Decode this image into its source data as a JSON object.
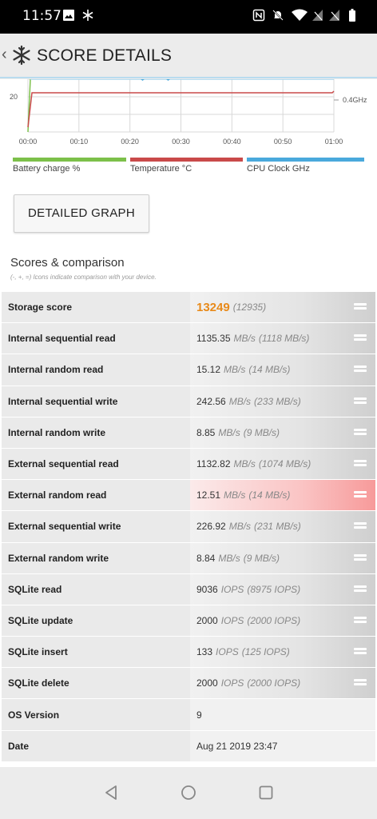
{
  "status": {
    "time": "11:57"
  },
  "app": {
    "title": "SCORE DETAILS"
  },
  "chart_data": {
    "type": "line",
    "x_ticks": [
      "00:00",
      "00:10",
      "00:20",
      "00:30",
      "00:40",
      "00:50",
      "01:00"
    ],
    "left_ticks": [
      "20"
    ],
    "right_ticks": [
      "0.4GHz"
    ],
    "series": [
      {
        "name": "Battery charge %",
        "color": "#7cc04a"
      },
      {
        "name": "Temperature °C",
        "color": "#c94a4a"
      },
      {
        "name": "CPU Clock GHz",
        "color": "#4aa9dc"
      }
    ]
  },
  "detailed_graph_label": "DETAILED GRAPH",
  "scores": {
    "title": "Scores & comparison",
    "subtitle": "(-, +, =) Icons indicate comparison with your device.",
    "rows": [
      {
        "label": "Storage score",
        "value": "13249",
        "unit": "",
        "compare": "(12935)"
      },
      {
        "label": "Internal sequential read",
        "value": "1135.35",
        "unit": "MB/s",
        "compare": "(1118 MB/s)"
      },
      {
        "label": "Internal random read",
        "value": "15.12",
        "unit": "MB/s",
        "compare": "(14 MB/s)"
      },
      {
        "label": "Internal sequential write",
        "value": "242.56",
        "unit": "MB/s",
        "compare": "(233 MB/s)"
      },
      {
        "label": "Internal random write",
        "value": "8.85",
        "unit": "MB/s",
        "compare": "(9 MB/s)"
      },
      {
        "label": "External sequential read",
        "value": "1132.82",
        "unit": "MB/s",
        "compare": "(1074 MB/s)"
      },
      {
        "label": "External random read",
        "value": "12.51",
        "unit": "MB/s",
        "compare": "(14 MB/s)"
      },
      {
        "label": "External sequential write",
        "value": "226.92",
        "unit": "MB/s",
        "compare": "(231 MB/s)"
      },
      {
        "label": "External random write",
        "value": "8.84",
        "unit": "MB/s",
        "compare": "(9 MB/s)"
      },
      {
        "label": "SQLite read",
        "value": "9036",
        "unit": "IOPS",
        "compare": "(8975 IOPS)"
      },
      {
        "label": "SQLite update",
        "value": "2000",
        "unit": "IOPS",
        "compare": "(2000 IOPS)"
      },
      {
        "label": "SQLite insert",
        "value": "133",
        "unit": "IOPS",
        "compare": "(125 IOPS)"
      },
      {
        "label": "SQLite delete",
        "value": "2000",
        "unit": "IOPS",
        "compare": "(2000 IOPS)"
      },
      {
        "label": "OS Version",
        "value": "9",
        "unit": "",
        "compare": ""
      },
      {
        "label": "Date",
        "value": "Aug 21 2019 23:47",
        "unit": "",
        "compare": ""
      }
    ]
  }
}
